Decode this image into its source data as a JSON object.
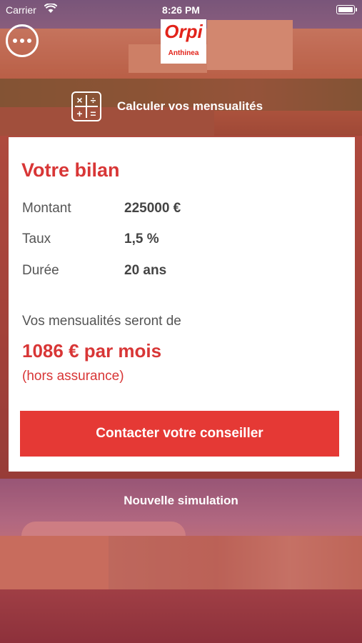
{
  "status_bar": {
    "carrier": "Carrier",
    "time": "8:26 PM"
  },
  "logo": {
    "brand": "Orpi",
    "agency": "Anthinea"
  },
  "header": {
    "calc_title": "Calculer vos mensualités"
  },
  "bilan": {
    "title": "Votre bilan",
    "rows": [
      {
        "label": "Montant",
        "value": "225000 €"
      },
      {
        "label": "Taux",
        "value": "1,5 %"
      },
      {
        "label": "Durée",
        "value": "20 ans"
      }
    ],
    "mens_intro": "Vos mensualités seront de",
    "mens_amount": "1086 € par mois",
    "mens_note": "(hors assurance)",
    "contact_label": "Contacter votre conseiller"
  },
  "new_simulation_label": "Nouvelle simulation",
  "colors": {
    "accent": "#e53935",
    "accent_text": "#d83636"
  },
  "icons": {
    "menu": "more-dots-icon",
    "calculator": "calculator-icon",
    "wifi": "wifi-icon",
    "battery": "battery-icon"
  }
}
